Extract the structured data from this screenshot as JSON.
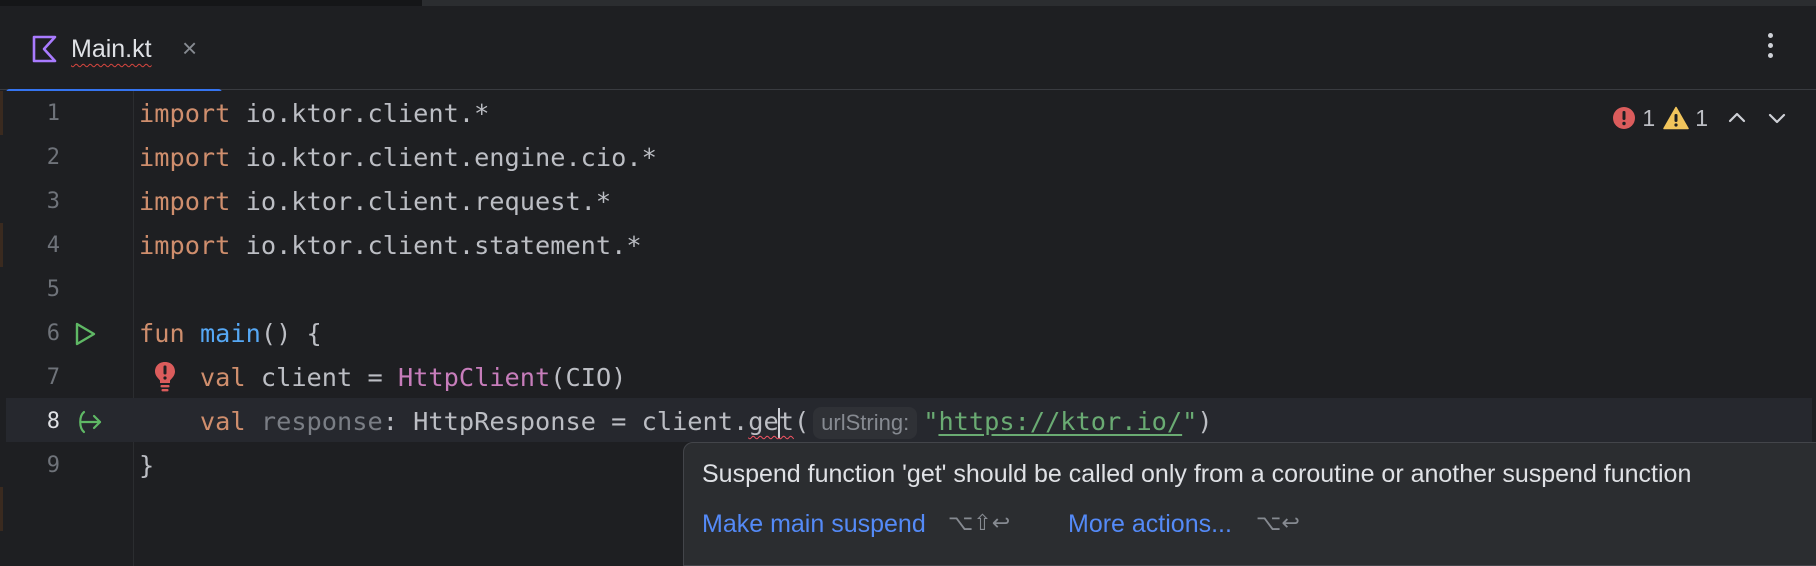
{
  "tab": {
    "label": "Main.kt",
    "close_glyph": "×",
    "icon": "kotlin-file-icon",
    "accent": "#3574f0"
  },
  "editor": {
    "lines": [
      {
        "num": "1",
        "parts": [
          {
            "t": "import",
            "c": "kw"
          },
          {
            "t": " io.ktor.client.*"
          }
        ]
      },
      {
        "num": "2",
        "parts": [
          {
            "t": "import",
            "c": "kw"
          },
          {
            "t": " io.ktor.client.engine.cio.*"
          }
        ]
      },
      {
        "num": "3",
        "parts": [
          {
            "t": "import",
            "c": "kw"
          },
          {
            "t": " io.ktor.client.request.*"
          }
        ]
      },
      {
        "num": "4",
        "parts": [
          {
            "t": "import",
            "c": "kw"
          },
          {
            "t": " io.ktor.client.statement.*"
          }
        ]
      },
      {
        "num": "5",
        "parts": []
      },
      {
        "num": "6",
        "parts": [
          {
            "t": "fun",
            "c": "kw"
          },
          {
            "t": " "
          },
          {
            "t": "main",
            "c": "fn"
          },
          {
            "t": "() {"
          }
        ]
      },
      {
        "num": "7",
        "parts": [
          {
            "t": "    "
          },
          {
            "t": "val",
            "c": "kw"
          },
          {
            "t": " client = "
          },
          {
            "t": "HttpClient",
            "c": "cls"
          },
          {
            "t": "(CIO)"
          }
        ]
      },
      {
        "num": "8",
        "parts": [
          {
            "t": "    "
          },
          {
            "t": "val",
            "c": "kw"
          },
          {
            "t": " "
          },
          {
            "t": "response",
            "c": "dim"
          },
          {
            "t": ": HttpResponse = client."
          },
          {
            "t": "ge",
            "c": "err-ul"
          },
          {
            "caret": true
          },
          {
            "t": "t",
            "c": "err-ul"
          },
          {
            "t": "("
          },
          {
            "hint": "urlString:"
          },
          {
            "t": "\"",
            "c": "str"
          },
          {
            "t": "https://ktor.io/",
            "c": "url"
          },
          {
            "t": "\"",
            "c": "str"
          },
          {
            "t": ")"
          }
        ]
      },
      {
        "num": "9",
        "parts": [
          {
            "t": "}"
          }
        ]
      }
    ],
    "active_line": "8"
  },
  "inspections": {
    "errors": "1",
    "warnings": "1",
    "error_color": "#db5c5c",
    "warning_color": "#f2c55c"
  },
  "popup": {
    "message": "Suspend function 'get' should be called only from a coroutine or another suspend function",
    "action_primary": "Make main suspend",
    "action_primary_shortcut": "⌥⇧↩",
    "action_more": "More actions...",
    "action_more_shortcut": "⌥↩"
  }
}
